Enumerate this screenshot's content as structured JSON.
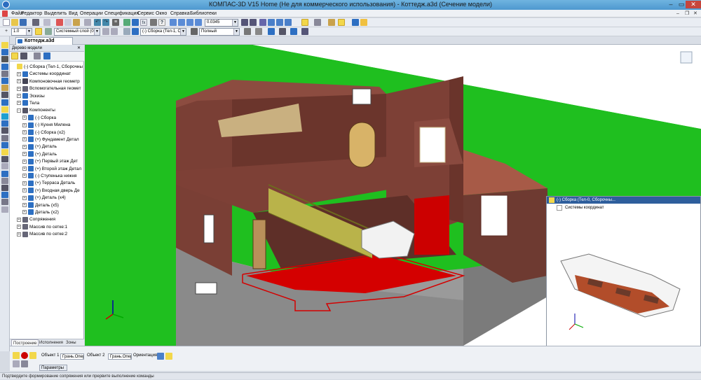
{
  "window": {
    "title": "КОМПАС-3D V15 Home (Не для коммерческого использования) - Коттедж.a3d (Сечение модели)"
  },
  "menu": [
    "Файл",
    "Редактор",
    "Выделить",
    "Вид",
    "Операции",
    "Спецификация",
    "Сервис",
    "Окно",
    "Справка",
    "Библиотеки"
  ],
  "toolbar": {
    "scale": "1.0",
    "layer": "Системный слой (0)",
    "assembly": "(-) Сборка (Тел-1, С",
    "zoom": "0.0345",
    "display": "Полный"
  },
  "document_tab": "Коттедж.a3d",
  "tree": {
    "header": "Дерево модели",
    "items": [
      {
        "label": "(-) Сборка (Тел-1, Сборочны",
        "level": 0
      },
      {
        "label": "Системы координат",
        "level": 1
      },
      {
        "label": "Компоновочная геометр",
        "level": 1
      },
      {
        "label": "Вспомогательная геомет",
        "level": 1
      },
      {
        "label": "Эскизы",
        "level": 1
      },
      {
        "label": "Тела",
        "level": 1
      },
      {
        "label": "Компоненты",
        "level": 1
      },
      {
        "label": "(-) Сборка",
        "level": 2
      },
      {
        "label": "(-) Кухня Милена",
        "level": 2
      },
      {
        "label": "(-) Сборка (x2)",
        "level": 2
      },
      {
        "label": "(+) Фундамент Детал",
        "level": 2
      },
      {
        "label": "(+) Деталь",
        "level": 2
      },
      {
        "label": "(+) Деталь",
        "level": 2
      },
      {
        "label": "(+) Первый этаж Дет",
        "level": 2
      },
      {
        "label": "(+) Второй этаж Детал",
        "level": 2
      },
      {
        "label": "(-) Ступенька нижня",
        "level": 2
      },
      {
        "label": "(+) Терраса Деталь",
        "level": 2
      },
      {
        "label": "(+) Входная дверь Де",
        "level": 2
      },
      {
        "label": "(+) Деталь (x4)",
        "level": 2
      },
      {
        "label": "Деталь (x5)",
        "level": 2
      },
      {
        "label": "Деталь (x2)",
        "level": 2
      },
      {
        "label": "Сопряжения",
        "level": 1
      },
      {
        "label": "Массив по сетке:1",
        "level": 1
      },
      {
        "label": "Массив по сетке:2",
        "level": 1
      }
    ],
    "tabs": [
      "Построение",
      "Исполнения",
      "Зоны"
    ]
  },
  "inset": {
    "header": "(-) Сборка (Тел-0, Сборочны...",
    "child": "Системы координат"
  },
  "properties": {
    "obj1": "Объект 1",
    "face1": "Грань.Опер",
    "obj2": "Объект 2",
    "face2": "Грань.Опер",
    "orient": "Ориентация",
    "tab": "Параметры"
  },
  "status": "Подтвердите формирование сопряжения или прервите выполнение команды",
  "colors": {
    "accent": "#4e98cf",
    "wall": "#7a3f35",
    "floor": "#d40000",
    "grass": "#1fbf1f",
    "stairs": "#b9b34a"
  }
}
